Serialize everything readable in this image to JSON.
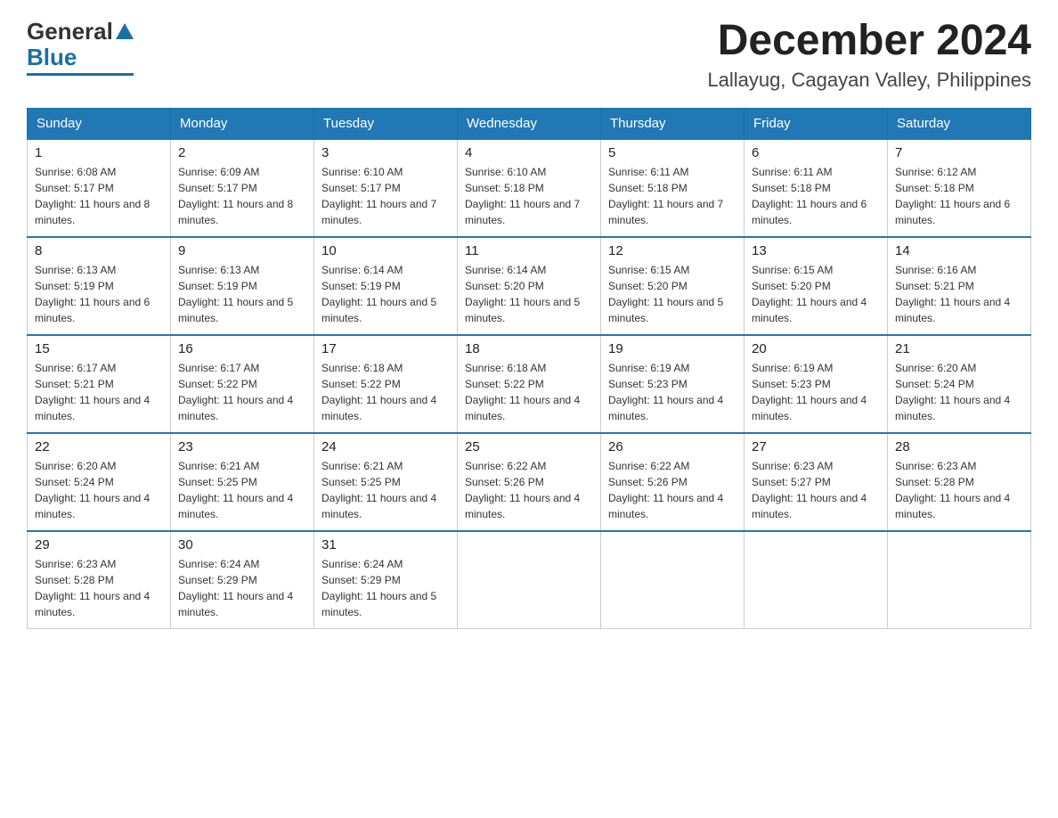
{
  "logo": {
    "general": "General",
    "blue": "Blue"
  },
  "title": "December 2024",
  "location": "Lallayug, Cagayan Valley, Philippines",
  "headers": [
    "Sunday",
    "Monday",
    "Tuesday",
    "Wednesday",
    "Thursday",
    "Friday",
    "Saturday"
  ],
  "weeks": [
    [
      {
        "day": "1",
        "sunrise": "6:08 AM",
        "sunset": "5:17 PM",
        "daylight": "11 hours and 8 minutes."
      },
      {
        "day": "2",
        "sunrise": "6:09 AM",
        "sunset": "5:17 PM",
        "daylight": "11 hours and 8 minutes."
      },
      {
        "day": "3",
        "sunrise": "6:10 AM",
        "sunset": "5:17 PM",
        "daylight": "11 hours and 7 minutes."
      },
      {
        "day": "4",
        "sunrise": "6:10 AM",
        "sunset": "5:18 PM",
        "daylight": "11 hours and 7 minutes."
      },
      {
        "day": "5",
        "sunrise": "6:11 AM",
        "sunset": "5:18 PM",
        "daylight": "11 hours and 7 minutes."
      },
      {
        "day": "6",
        "sunrise": "6:11 AM",
        "sunset": "5:18 PM",
        "daylight": "11 hours and 6 minutes."
      },
      {
        "day": "7",
        "sunrise": "6:12 AM",
        "sunset": "5:18 PM",
        "daylight": "11 hours and 6 minutes."
      }
    ],
    [
      {
        "day": "8",
        "sunrise": "6:13 AM",
        "sunset": "5:19 PM",
        "daylight": "11 hours and 6 minutes."
      },
      {
        "day": "9",
        "sunrise": "6:13 AM",
        "sunset": "5:19 PM",
        "daylight": "11 hours and 5 minutes."
      },
      {
        "day": "10",
        "sunrise": "6:14 AM",
        "sunset": "5:19 PM",
        "daylight": "11 hours and 5 minutes."
      },
      {
        "day": "11",
        "sunrise": "6:14 AM",
        "sunset": "5:20 PM",
        "daylight": "11 hours and 5 minutes."
      },
      {
        "day": "12",
        "sunrise": "6:15 AM",
        "sunset": "5:20 PM",
        "daylight": "11 hours and 5 minutes."
      },
      {
        "day": "13",
        "sunrise": "6:15 AM",
        "sunset": "5:20 PM",
        "daylight": "11 hours and 4 minutes."
      },
      {
        "day": "14",
        "sunrise": "6:16 AM",
        "sunset": "5:21 PM",
        "daylight": "11 hours and 4 minutes."
      }
    ],
    [
      {
        "day": "15",
        "sunrise": "6:17 AM",
        "sunset": "5:21 PM",
        "daylight": "11 hours and 4 minutes."
      },
      {
        "day": "16",
        "sunrise": "6:17 AM",
        "sunset": "5:22 PM",
        "daylight": "11 hours and 4 minutes."
      },
      {
        "day": "17",
        "sunrise": "6:18 AM",
        "sunset": "5:22 PM",
        "daylight": "11 hours and 4 minutes."
      },
      {
        "day": "18",
        "sunrise": "6:18 AM",
        "sunset": "5:22 PM",
        "daylight": "11 hours and 4 minutes."
      },
      {
        "day": "19",
        "sunrise": "6:19 AM",
        "sunset": "5:23 PM",
        "daylight": "11 hours and 4 minutes."
      },
      {
        "day": "20",
        "sunrise": "6:19 AM",
        "sunset": "5:23 PM",
        "daylight": "11 hours and 4 minutes."
      },
      {
        "day": "21",
        "sunrise": "6:20 AM",
        "sunset": "5:24 PM",
        "daylight": "11 hours and 4 minutes."
      }
    ],
    [
      {
        "day": "22",
        "sunrise": "6:20 AM",
        "sunset": "5:24 PM",
        "daylight": "11 hours and 4 minutes."
      },
      {
        "day": "23",
        "sunrise": "6:21 AM",
        "sunset": "5:25 PM",
        "daylight": "11 hours and 4 minutes."
      },
      {
        "day": "24",
        "sunrise": "6:21 AM",
        "sunset": "5:25 PM",
        "daylight": "11 hours and 4 minutes."
      },
      {
        "day": "25",
        "sunrise": "6:22 AM",
        "sunset": "5:26 PM",
        "daylight": "11 hours and 4 minutes."
      },
      {
        "day": "26",
        "sunrise": "6:22 AM",
        "sunset": "5:26 PM",
        "daylight": "11 hours and 4 minutes."
      },
      {
        "day": "27",
        "sunrise": "6:23 AM",
        "sunset": "5:27 PM",
        "daylight": "11 hours and 4 minutes."
      },
      {
        "day": "28",
        "sunrise": "6:23 AM",
        "sunset": "5:28 PM",
        "daylight": "11 hours and 4 minutes."
      }
    ],
    [
      {
        "day": "29",
        "sunrise": "6:23 AM",
        "sunset": "5:28 PM",
        "daylight": "11 hours and 4 minutes."
      },
      {
        "day": "30",
        "sunrise": "6:24 AM",
        "sunset": "5:29 PM",
        "daylight": "11 hours and 4 minutes."
      },
      {
        "day": "31",
        "sunrise": "6:24 AM",
        "sunset": "5:29 PM",
        "daylight": "11 hours and 5 minutes."
      },
      null,
      null,
      null,
      null
    ]
  ]
}
